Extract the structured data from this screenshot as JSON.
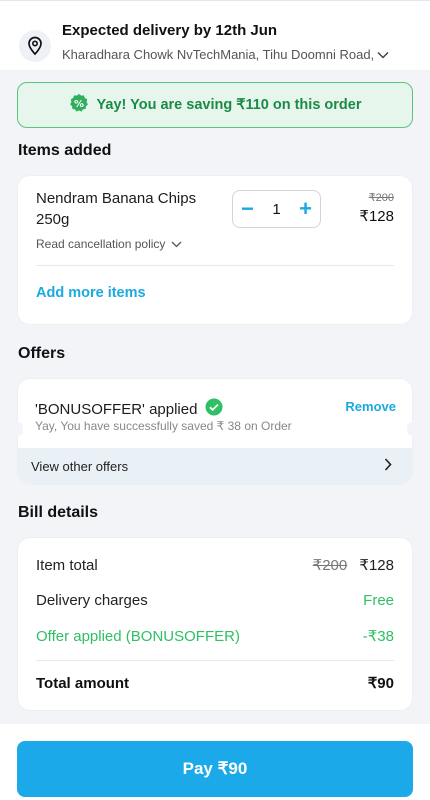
{
  "header": {
    "title": "Expected delivery by 12th Jun",
    "address": "Kharadhara Chowk NvTechMania, Tihu Doomni Road,"
  },
  "savings_banner": {
    "text": "Yay! You are saving ₹110 on this order"
  },
  "items_section": {
    "title": "Items added",
    "items": [
      {
        "name": "Nendram Banana Chips 250g",
        "quantity": "1",
        "original_price": "₹200",
        "price": "₹128",
        "policy_link": "Read cancellation policy"
      }
    ],
    "add_more_label": "Add more items"
  },
  "offers_section": {
    "title": "Offers",
    "applied_code_text": "'BONUSOFFER' applied",
    "applied_message": "Yay, You have successfully saved ₹ 38 on Order",
    "remove_label": "Remove",
    "view_other_label": "View other offers"
  },
  "bill": {
    "title": "Bill details",
    "item_total_label": "Item total",
    "item_total_original": "₹200",
    "item_total_value": "₹128",
    "delivery_label": "Delivery charges",
    "delivery_value": "Free",
    "offer_label": "Offer applied (BONUSOFFER)",
    "offer_value": "-₹38",
    "total_label": "Total amount",
    "total_value": "₹90"
  },
  "pay_button": {
    "label": "Pay ₹90"
  },
  "colors": {
    "accent": "#1ba9e9",
    "success": "#2fbf64",
    "banner_bg": "#e6f6ec"
  }
}
